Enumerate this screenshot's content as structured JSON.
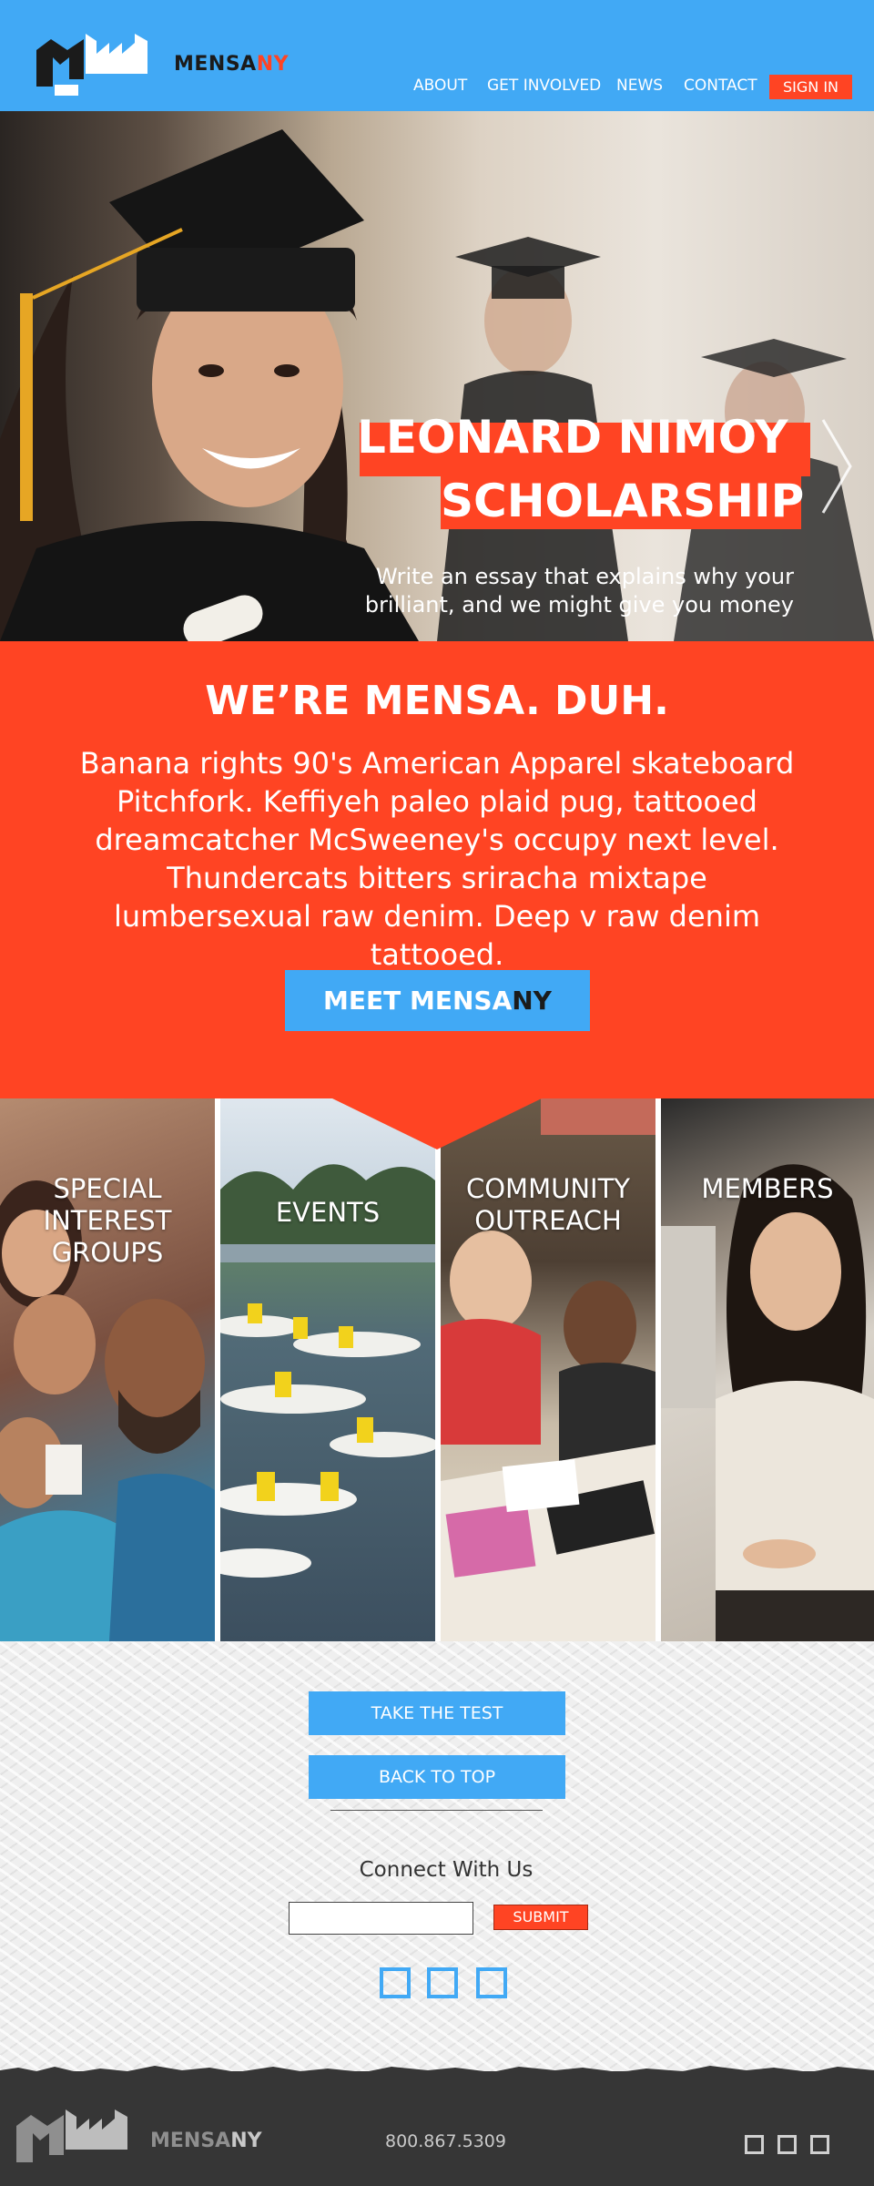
{
  "brand": {
    "name_main": "MENSA",
    "name_accent": "NY",
    "colors": {
      "blue": "#41a9f5",
      "orange": "#ff4423",
      "dark": "#363636"
    }
  },
  "nav": {
    "items": [
      {
        "label": "ABOUT"
      },
      {
        "label": "GET INVOLVED"
      },
      {
        "label": "NEWS"
      },
      {
        "label": "CONTACT"
      }
    ],
    "sign_in": "SIGN IN"
  },
  "hero": {
    "title_line1": "LEONARD NIMOY",
    "title_line2": "SCHOLARSHIP",
    "subtitle": "Write an essay that explains why your brilliant, and we might give you money",
    "next_icon": "chevron-right-icon"
  },
  "intro": {
    "heading": "WE’RE MENSA. DUH.",
    "body": "Banana rights 90's American Apparel skateboard Pitchfork. Keffiyeh paleo plaid pug, tattooed dreamcatcher McSweeney's occupy next level. Thundercats bitters sriracha mixtape lumbersexual raw denim. Deep v raw denim tattooed.",
    "button_main": "MEET MENSA",
    "button_accent": "NY"
  },
  "tiles": [
    {
      "label": "SPECIAL INTEREST GROUPS"
    },
    {
      "label": "EVENTS"
    },
    {
      "label": "COMMUNITY OUTREACH"
    },
    {
      "label": "MEMBERS"
    }
  ],
  "footer": {
    "take_test": "TAKE THE TEST",
    "back_to_top": "BACK TO TOP",
    "connect_heading": "Connect With Us",
    "email_value": "",
    "submit": "SUBMIT",
    "social_icons": [
      "social-icon",
      "social-icon",
      "social-icon"
    ]
  },
  "bottom_bar": {
    "name_main": "MENSA",
    "name_accent": "NY",
    "phone": "800.867.5309",
    "icons": [
      "square-icon",
      "square-icon",
      "square-icon"
    ]
  }
}
